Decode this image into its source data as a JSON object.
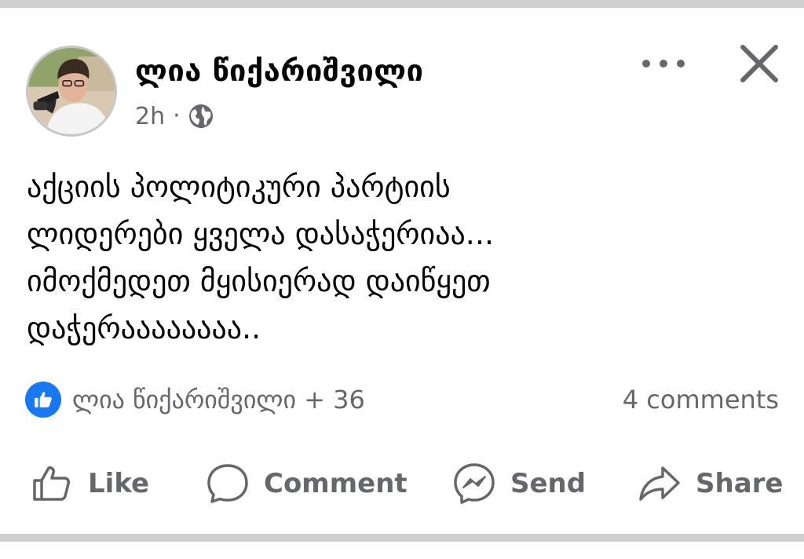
{
  "post": {
    "author": "ლია წიქარიშვილი",
    "time": "2h",
    "separator": "·",
    "privacy_icon": "globe-icon",
    "body_lines": [
      "აქციის პოლიტიკური პარტიის",
      "ლიდერები ყველა დასაჭერიაა...",
      "იმოქმედეთ მყისიერად დაიწყეთ",
      "დაჭერაააააააა.."
    ]
  },
  "reactions": {
    "icon": "like-reaction-icon",
    "text": "ლია წიქარიშვილი + 36",
    "comments": "4 comments"
  },
  "actions": {
    "like": "Like",
    "comment": "Comment",
    "send": "Send",
    "share": "Share"
  },
  "colors": {
    "text": "#050505",
    "muted": "#65676b",
    "like_blue": "#1877f2",
    "separator": "#cfcfcf"
  }
}
